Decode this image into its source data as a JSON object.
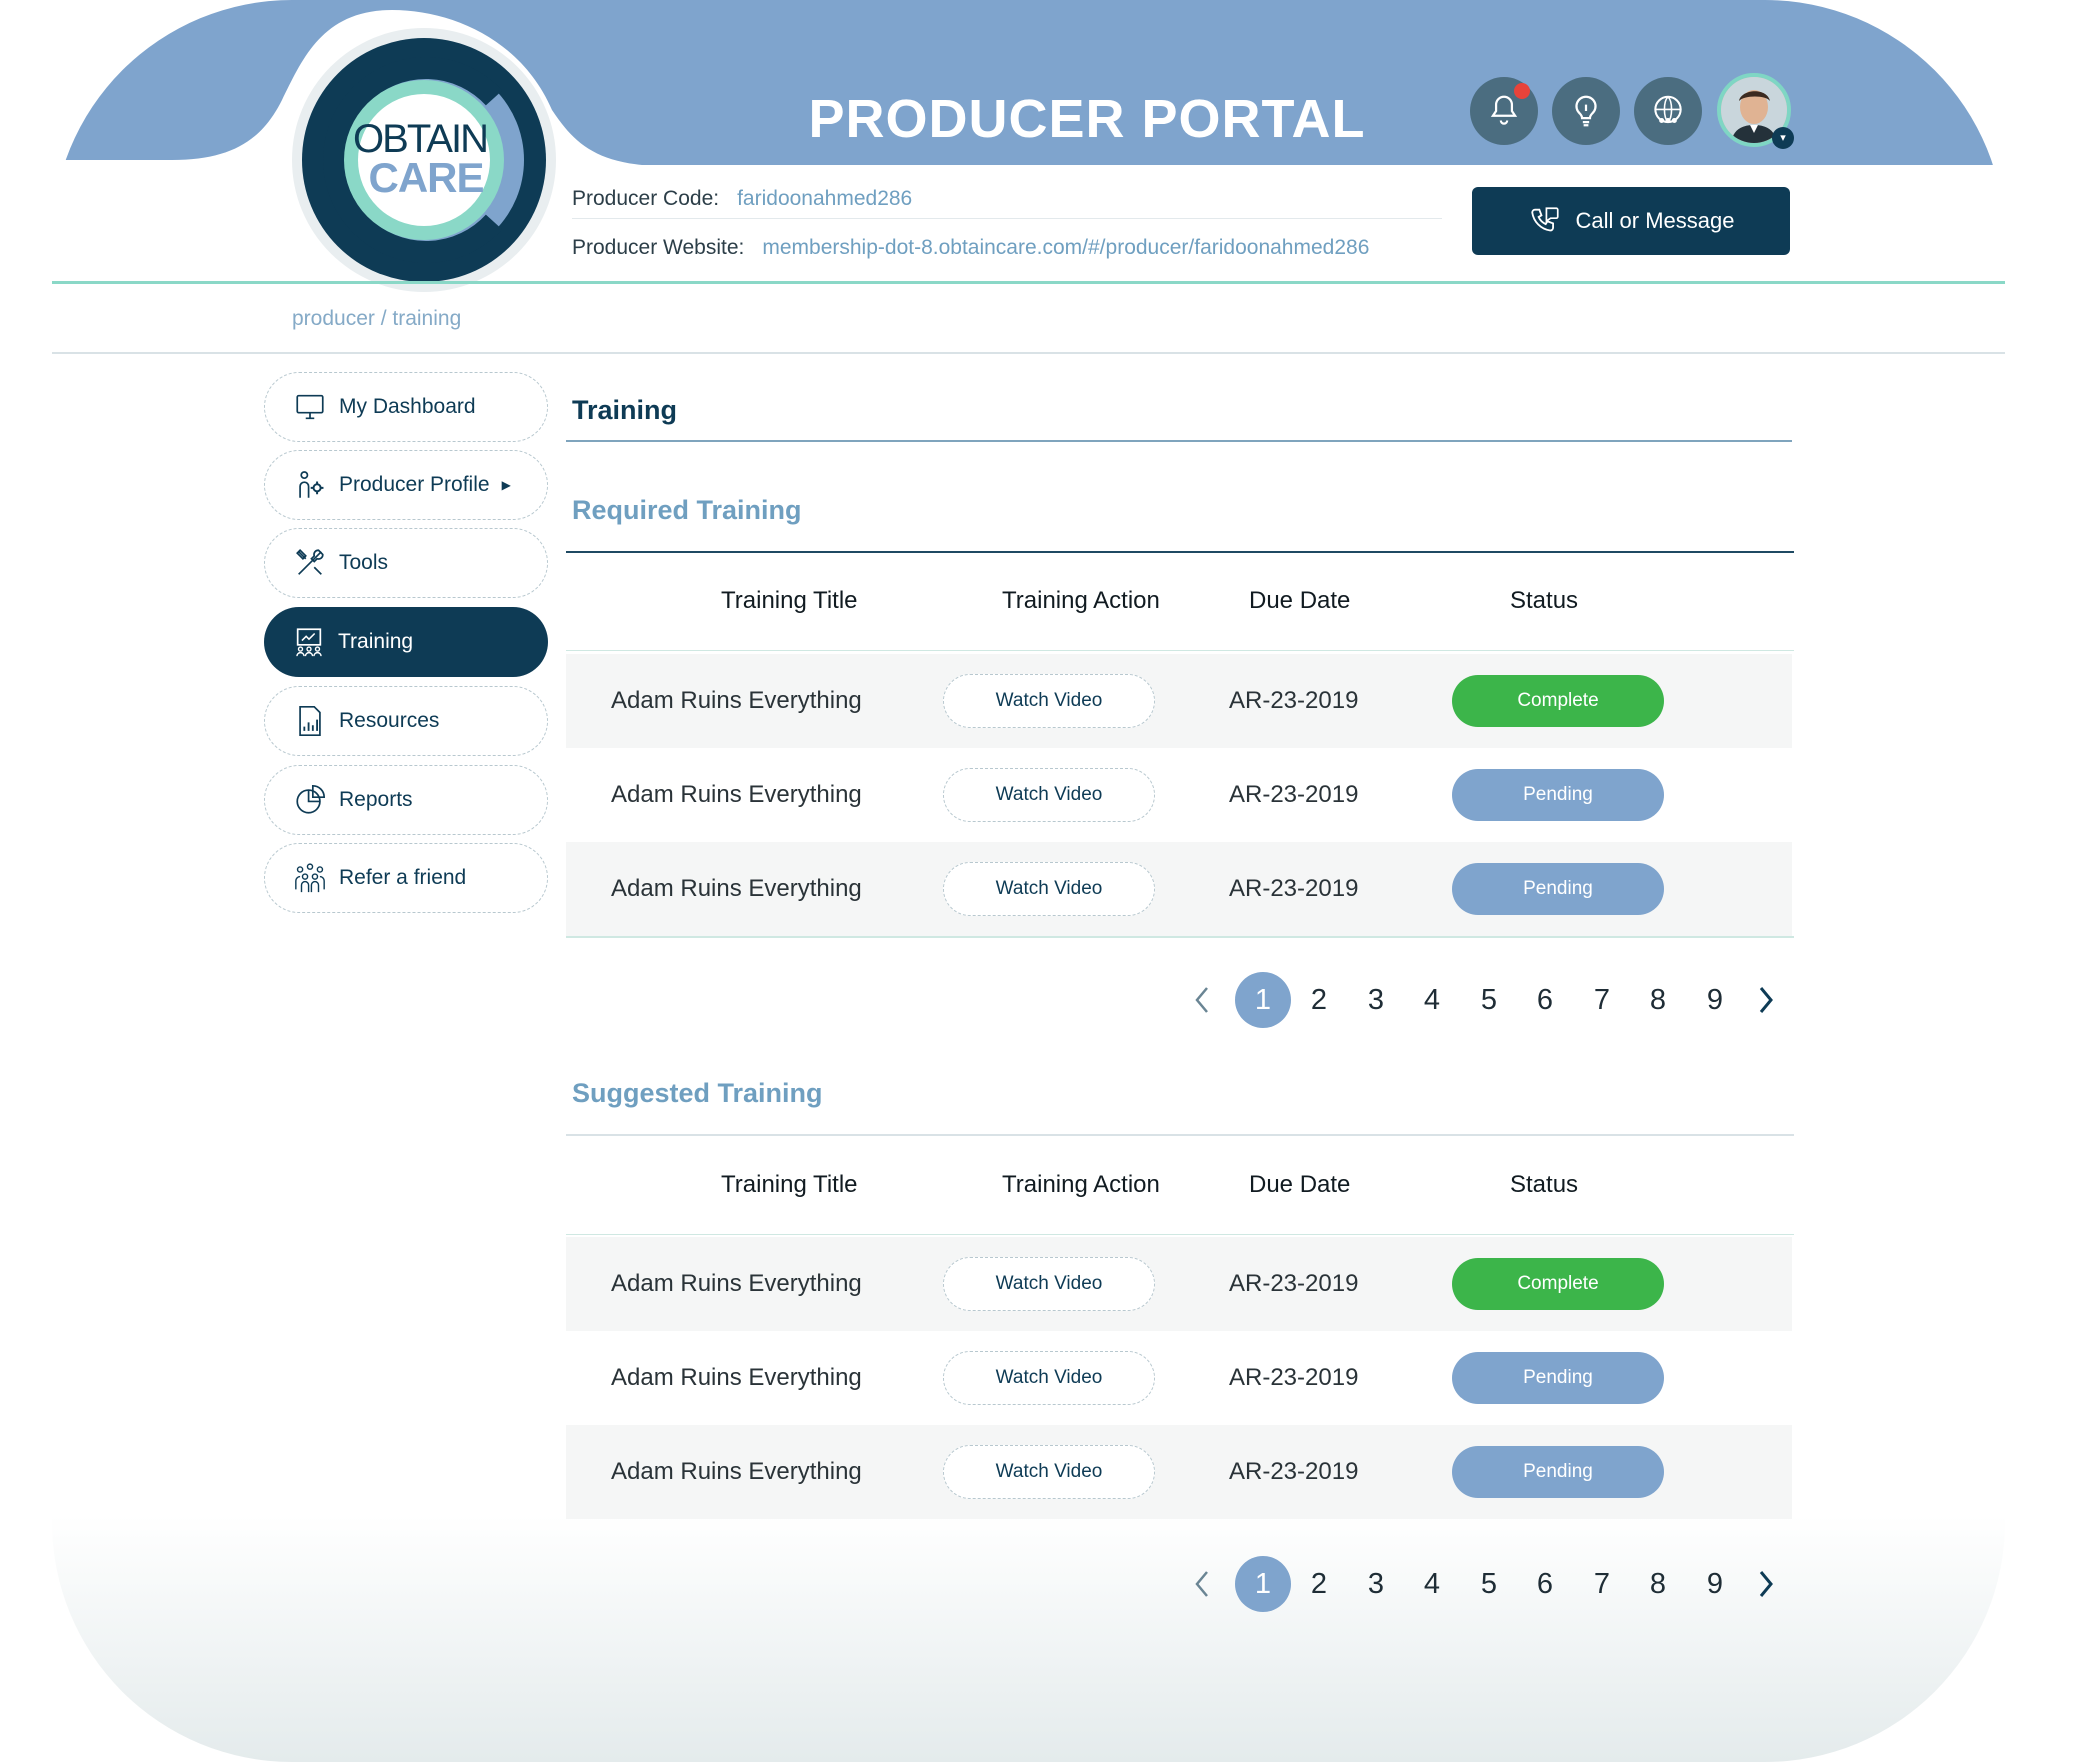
{
  "header": {
    "title": "PRODUCER PORTAL",
    "logo_line1": "OBTAIN",
    "logo_line2": "CARE",
    "producer_code_label": "Producer Code:",
    "producer_code": "faridoonahmed286",
    "producer_website_label": "Producer Website:",
    "producer_website": "membership-dot-8.obtaincare.com/#/producer/faridoonahmed286",
    "call_button": "Call or Message",
    "icons": [
      "bell-icon",
      "lightbulb-icon",
      "globe-people-icon"
    ]
  },
  "breadcrumb": "producer / training",
  "sidebar": {
    "items": [
      {
        "label": "My Dashboard",
        "icon": "monitor-icon"
      },
      {
        "label": "Producer Profile",
        "icon": "profile-gear-icon"
      },
      {
        "label": "Tools",
        "icon": "tools-icon"
      },
      {
        "label": "Training",
        "icon": "training-board-icon",
        "active": true
      },
      {
        "label": "Resources",
        "icon": "document-chart-icon"
      },
      {
        "label": "Reports",
        "icon": "pie-chart-icon"
      },
      {
        "label": "Refer a friend",
        "icon": "group-people-icon"
      }
    ]
  },
  "main": {
    "title": "Training",
    "columns": [
      "Training Title",
      "Training Action",
      "Due Date",
      "Status"
    ],
    "required": {
      "title": "Required Training",
      "rows": [
        {
          "title": "Adam Ruins Everything",
          "action": "Watch Video",
          "due": "AR-23-2019",
          "status": "Complete"
        },
        {
          "title": "Adam Ruins Everything",
          "action": "Watch Video",
          "due": "AR-23-2019",
          "status": "Pending"
        },
        {
          "title": "Adam Ruins Everything",
          "action": "Watch Video",
          "due": "AR-23-2019",
          "status": "Pending"
        }
      ],
      "pages": [
        "1",
        "2",
        "3",
        "4",
        "5",
        "6",
        "7",
        "8",
        "9"
      ],
      "current_page": "1"
    },
    "suggested": {
      "title": "Suggested Training",
      "rows": [
        {
          "title": "Adam Ruins Everything",
          "action": "Watch Video",
          "due": "AR-23-2019",
          "status": "Complete"
        },
        {
          "title": "Adam Ruins Everything",
          "action": "Watch Video",
          "due": "AR-23-2019",
          "status": "Pending"
        },
        {
          "title": "Adam Ruins Everything",
          "action": "Watch Video",
          "due": "AR-23-2019",
          "status": "Pending"
        }
      ],
      "pages": [
        "1",
        "2",
        "3",
        "4",
        "5",
        "6",
        "7",
        "8",
        "9"
      ],
      "current_page": "1"
    }
  },
  "colors": {
    "header_blue": "#7fa4cd",
    "navy": "#0e3b55",
    "teal": "#8ad8c7",
    "complete_green": "#3cb54a",
    "pending_blue": "#7fa4cd",
    "link_blue": "#6f9fc0"
  }
}
